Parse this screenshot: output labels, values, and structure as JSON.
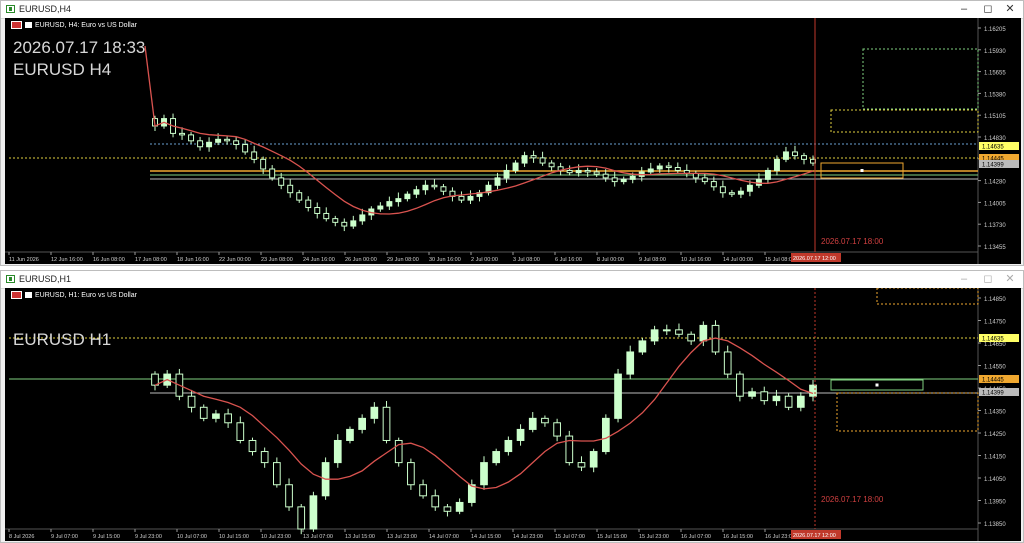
{
  "colors": {
    "bg": "#000000",
    "axis_text": "#cfcfcf",
    "candle": "#ccffcc",
    "ma": "#d9534f",
    "level_orange": "#f0a830",
    "level_green": "#7fd07f",
    "level_yellow": "#ffff66",
    "vline": "#c0392b",
    "time_label": "#d04040"
  },
  "window1": {
    "title": "EURUSD,H4",
    "symbol_label": "EURUSD, H4: Euro vs US Dollar",
    "overlay_datetime": "2026.07.17 18:33",
    "overlay_symbol": "EURUSD H4",
    "time_marker": "2026.07.17 18:00",
    "time_marker_axis": "2026.07.17 12:00",
    "price_axis": [
      "1.16205",
      "1.15930",
      "1.15655",
      "1.15380",
      "1.15105",
      "1.14830",
      "1.14555",
      "1.14280",
      "1.14005",
      "1.13730",
      "1.13455"
    ],
    "price_badges": [
      {
        "text": "1.14635",
        "color": "#ffff66"
      },
      {
        "text": "1.14445",
        "color": "#f0a830"
      },
      {
        "text": "1.14399",
        "color": "#bbbbbb"
      }
    ],
    "time_axis": [
      "11 Jun 2026",
      "12 Jun 16:00",
      "16 Jun 08:00",
      "17 Jun 08:00",
      "18 Jun 16:00",
      "22 Jun 00:00",
      "23 Jun 08:00",
      "24 Jun 16:00",
      "26 Jun 00:00",
      "29 Jun 08:00",
      "30 Jun 16:00",
      "2 Jul 00:00",
      "3 Jul 08:00",
      "6 Jul 16:00",
      "8 Jul 00:00",
      "9 Jul 08:00",
      "10 Jul 16:00",
      "14 Jul 00:00",
      "15 Jul 08:00"
    ]
  },
  "window2": {
    "title": "EURUSD,H1",
    "symbol_label": "EURUSD, H1: Euro vs US Dollar",
    "overlay_symbol": "EURUSD H1",
    "time_marker": "2026.07.17 18:00",
    "time_marker_axis": "2026.07.17 12:00",
    "price_axis": [
      "1.14850",
      "1.14750",
      "1.14650",
      "1.14550",
      "1.14450",
      "1.14350",
      "1.14250",
      "1.14150",
      "1.14050",
      "1.13950",
      "1.13850"
    ],
    "price_badges": [
      {
        "text": "1.14635",
        "color": "#ffff66"
      },
      {
        "text": "1.14445",
        "color": "#f0a830"
      },
      {
        "text": "1.14399",
        "color": "#bbbbbb"
      }
    ],
    "time_axis": [
      "8 Jul 2026",
      "9 Jul 07:00",
      "9 Jul 15:00",
      "9 Jul 23:00",
      "10 Jul 07:00",
      "10 Jul 15:00",
      "10 Jul 23:00",
      "13 Jul 07:00",
      "13 Jul 15:00",
      "13 Jul 23:00",
      "14 Jul 07:00",
      "14 Jul 15:00",
      "14 Jul 23:00",
      "15 Jul 07:00",
      "15 Jul 15:00",
      "15 Jul 23:00",
      "16 Jul 07:00",
      "16 Jul 15:00",
      "16 Jul 23:00"
    ]
  },
  "chart_data": [
    {
      "type": "candlestick",
      "title": "EURUSD, H4: Euro vs US Dollar",
      "ylim": [
        1.132,
        1.1633
      ],
      "series": [
        {
          "name": "price",
          "values": [
            1.149,
            1.15,
            1.148,
            1.1478,
            1.147,
            1.1462,
            1.1468,
            1.1472,
            1.147,
            1.1465,
            1.1455,
            1.1445,
            1.1432,
            1.142,
            1.141,
            1.14,
            1.139,
            1.138,
            1.1372,
            1.1365,
            1.136,
            1.1355,
            1.1362,
            1.137,
            1.1378,
            1.1382,
            1.1388,
            1.1392,
            1.1398,
            1.1404,
            1.141,
            1.1408,
            1.1402,
            1.1395,
            1.139,
            1.1395,
            1.14,
            1.141,
            1.142,
            1.143,
            1.144,
            1.145,
            1.1447,
            1.144,
            1.1435,
            1.143,
            1.1427,
            1.143,
            1.1428,
            1.1425,
            1.142,
            1.1415,
            1.1418,
            1.1422,
            1.1428,
            1.1432,
            1.1436,
            1.1434,
            1.143,
            1.1426,
            1.142,
            1.1415,
            1.1408,
            1.14,
            1.1398,
            1.1402,
            1.141,
            1.1418,
            1.143,
            1.1445,
            1.1455,
            1.145,
            1.1445,
            1.144
          ]
        }
      ]
    },
    {
      "type": "candlestick",
      "title": "EURUSD, H1: Euro vs US Dollar",
      "ylim": [
        1.138,
        1.1488
      ],
      "series": [
        {
          "name": "price",
          "values": [
            1.1445,
            1.145,
            1.144,
            1.1435,
            1.143,
            1.1432,
            1.1428,
            1.142,
            1.1415,
            1.141,
            1.14,
            1.139,
            1.138,
            1.1395,
            1.141,
            1.142,
            1.1425,
            1.143,
            1.1435,
            1.142,
            1.141,
            1.14,
            1.1395,
            1.139,
            1.1388,
            1.1392,
            1.14,
            1.141,
            1.1415,
            1.142,
            1.1425,
            1.143,
            1.1428,
            1.1422,
            1.141,
            1.1408,
            1.1415,
            1.143,
            1.145,
            1.146,
            1.1465,
            1.147,
            1.147,
            1.1468,
            1.1465,
            1.1472,
            1.146,
            1.145,
            1.144,
            1.1442,
            1.1438,
            1.144,
            1.1435,
            1.144,
            1.1445
          ]
        }
      ]
    }
  ]
}
